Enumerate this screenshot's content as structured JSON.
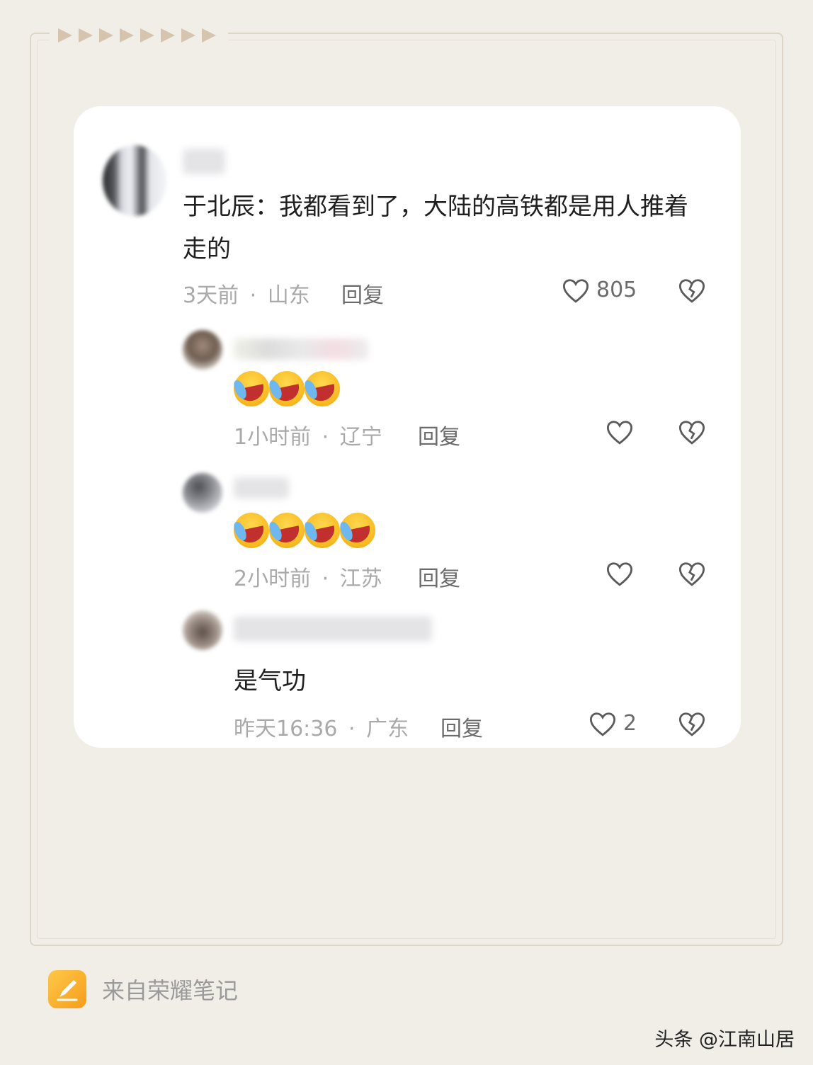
{
  "comments": [
    {
      "text": "于北辰：我都看到了，大陆的高铁都是用人推着走的",
      "time": "3天前",
      "location": "山东",
      "reply_label": "回复",
      "like_count": "805"
    },
    {
      "emoji_count": 3,
      "emoji_icon": "crying-laughing-face",
      "time": "1小时前",
      "location": "辽宁",
      "reply_label": "回复",
      "like_count": ""
    },
    {
      "emoji_count": 4,
      "emoji_icon": "crying-laughing-face",
      "time": "2小时前",
      "location": "江苏",
      "reply_label": "回复",
      "like_count": ""
    },
    {
      "text": "是气功",
      "time": "昨天16:36",
      "location": "广东",
      "reply_label": "回复",
      "like_count": "2"
    }
  ],
  "meta_separator": "·",
  "footer": {
    "source_text": "来自荣耀笔记",
    "watermark": "头条 @江南山居"
  },
  "icons": {
    "like": "heart-outline-icon",
    "dislike": "broken-heart-icon",
    "app": "pencil-note-icon"
  },
  "colors": {
    "background": "#f0eee6",
    "card": "#ffffff",
    "meta_text": "#a9a9a9",
    "reply_text": "#6b6b6b",
    "accent_arrows": "#d5c4ae",
    "app_icon": "#f8b62d"
  }
}
